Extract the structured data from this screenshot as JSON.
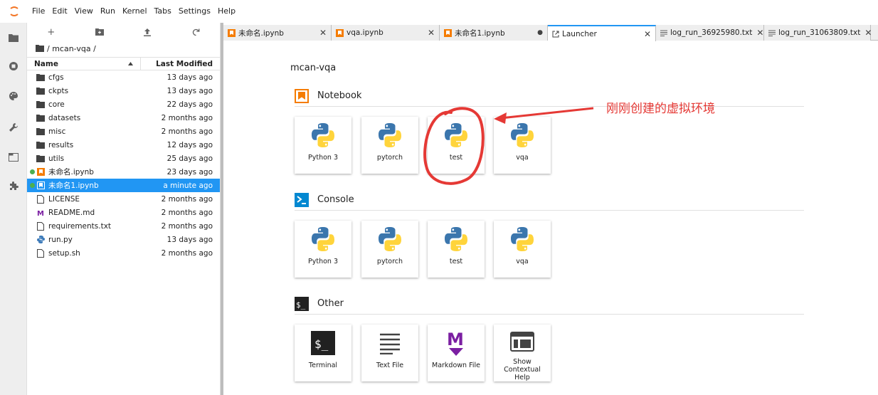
{
  "menu": [
    "File",
    "Edit",
    "View",
    "Run",
    "Kernel",
    "Tabs",
    "Settings",
    "Help"
  ],
  "filebrowser": {
    "breadcrumb": "/ mcan-vqa /",
    "col_name": "Name",
    "col_modified": "Last Modified",
    "rows": [
      {
        "name": "cfgs",
        "modified": "13 days ago",
        "type": "folder"
      },
      {
        "name": "ckpts",
        "modified": "13 days ago",
        "type": "folder"
      },
      {
        "name": "core",
        "modified": "22 days ago",
        "type": "folder"
      },
      {
        "name": "datasets",
        "modified": "2 months ago",
        "type": "folder"
      },
      {
        "name": "misc",
        "modified": "2 months ago",
        "type": "folder"
      },
      {
        "name": "results",
        "modified": "12 days ago",
        "type": "folder"
      },
      {
        "name": "utils",
        "modified": "25 days ago",
        "type": "folder"
      },
      {
        "name": "未命名.ipynb",
        "modified": "23 days ago",
        "type": "notebook",
        "running": true
      },
      {
        "name": "未命名1.ipynb",
        "modified": "a minute ago",
        "type": "notebook",
        "running": true,
        "selected": true
      },
      {
        "name": "LICENSE",
        "modified": "2 months ago",
        "type": "file"
      },
      {
        "name": "README.md",
        "modified": "2 months ago",
        "type": "markdown"
      },
      {
        "name": "requirements.txt",
        "modified": "2 months ago",
        "type": "file"
      },
      {
        "name": "run.py",
        "modified": "13 days ago",
        "type": "python"
      },
      {
        "name": "setup.sh",
        "modified": "2 months ago",
        "type": "file"
      }
    ]
  },
  "tabs": [
    {
      "label": "未命名.ipynb",
      "icon": "notebook",
      "width": 152
    },
    {
      "label": "vqa.ipynb",
      "icon": "notebook",
      "width": 152
    },
    {
      "label": "未命名1.ipynb",
      "icon": "notebook",
      "width": 152,
      "dirty": true
    },
    {
      "label": "Launcher",
      "icon": "launcher",
      "width": 152,
      "active": true
    },
    {
      "label": "log_run_36925980.txt",
      "icon": "text",
      "width": 152
    },
    {
      "label": "log_run_31063809.txt",
      "icon": "text",
      "width": 150
    }
  ],
  "launcher": {
    "title": "mcan-vqa",
    "sections": [
      {
        "name": "Notebook",
        "icon": "notebook",
        "items": [
          "Python 3",
          "pytorch",
          "test",
          "vqa"
        ]
      },
      {
        "name": "Console",
        "icon": "console",
        "items": [
          "Python 3",
          "pytorch",
          "test",
          "vqa"
        ]
      },
      {
        "name": "Other",
        "icon": "terminal",
        "items": [
          "Terminal",
          "Text File",
          "Markdown File",
          "Show Contextual Help"
        ]
      }
    ]
  },
  "annotation": "刚刚创建的虚拟环境",
  "colors": {
    "accent": "#2196f3",
    "notebook_orange": "#f57c00",
    "annotation_red": "#e53935",
    "running_green": "#4caf50",
    "markdown_purple": "#7b1fa2"
  }
}
